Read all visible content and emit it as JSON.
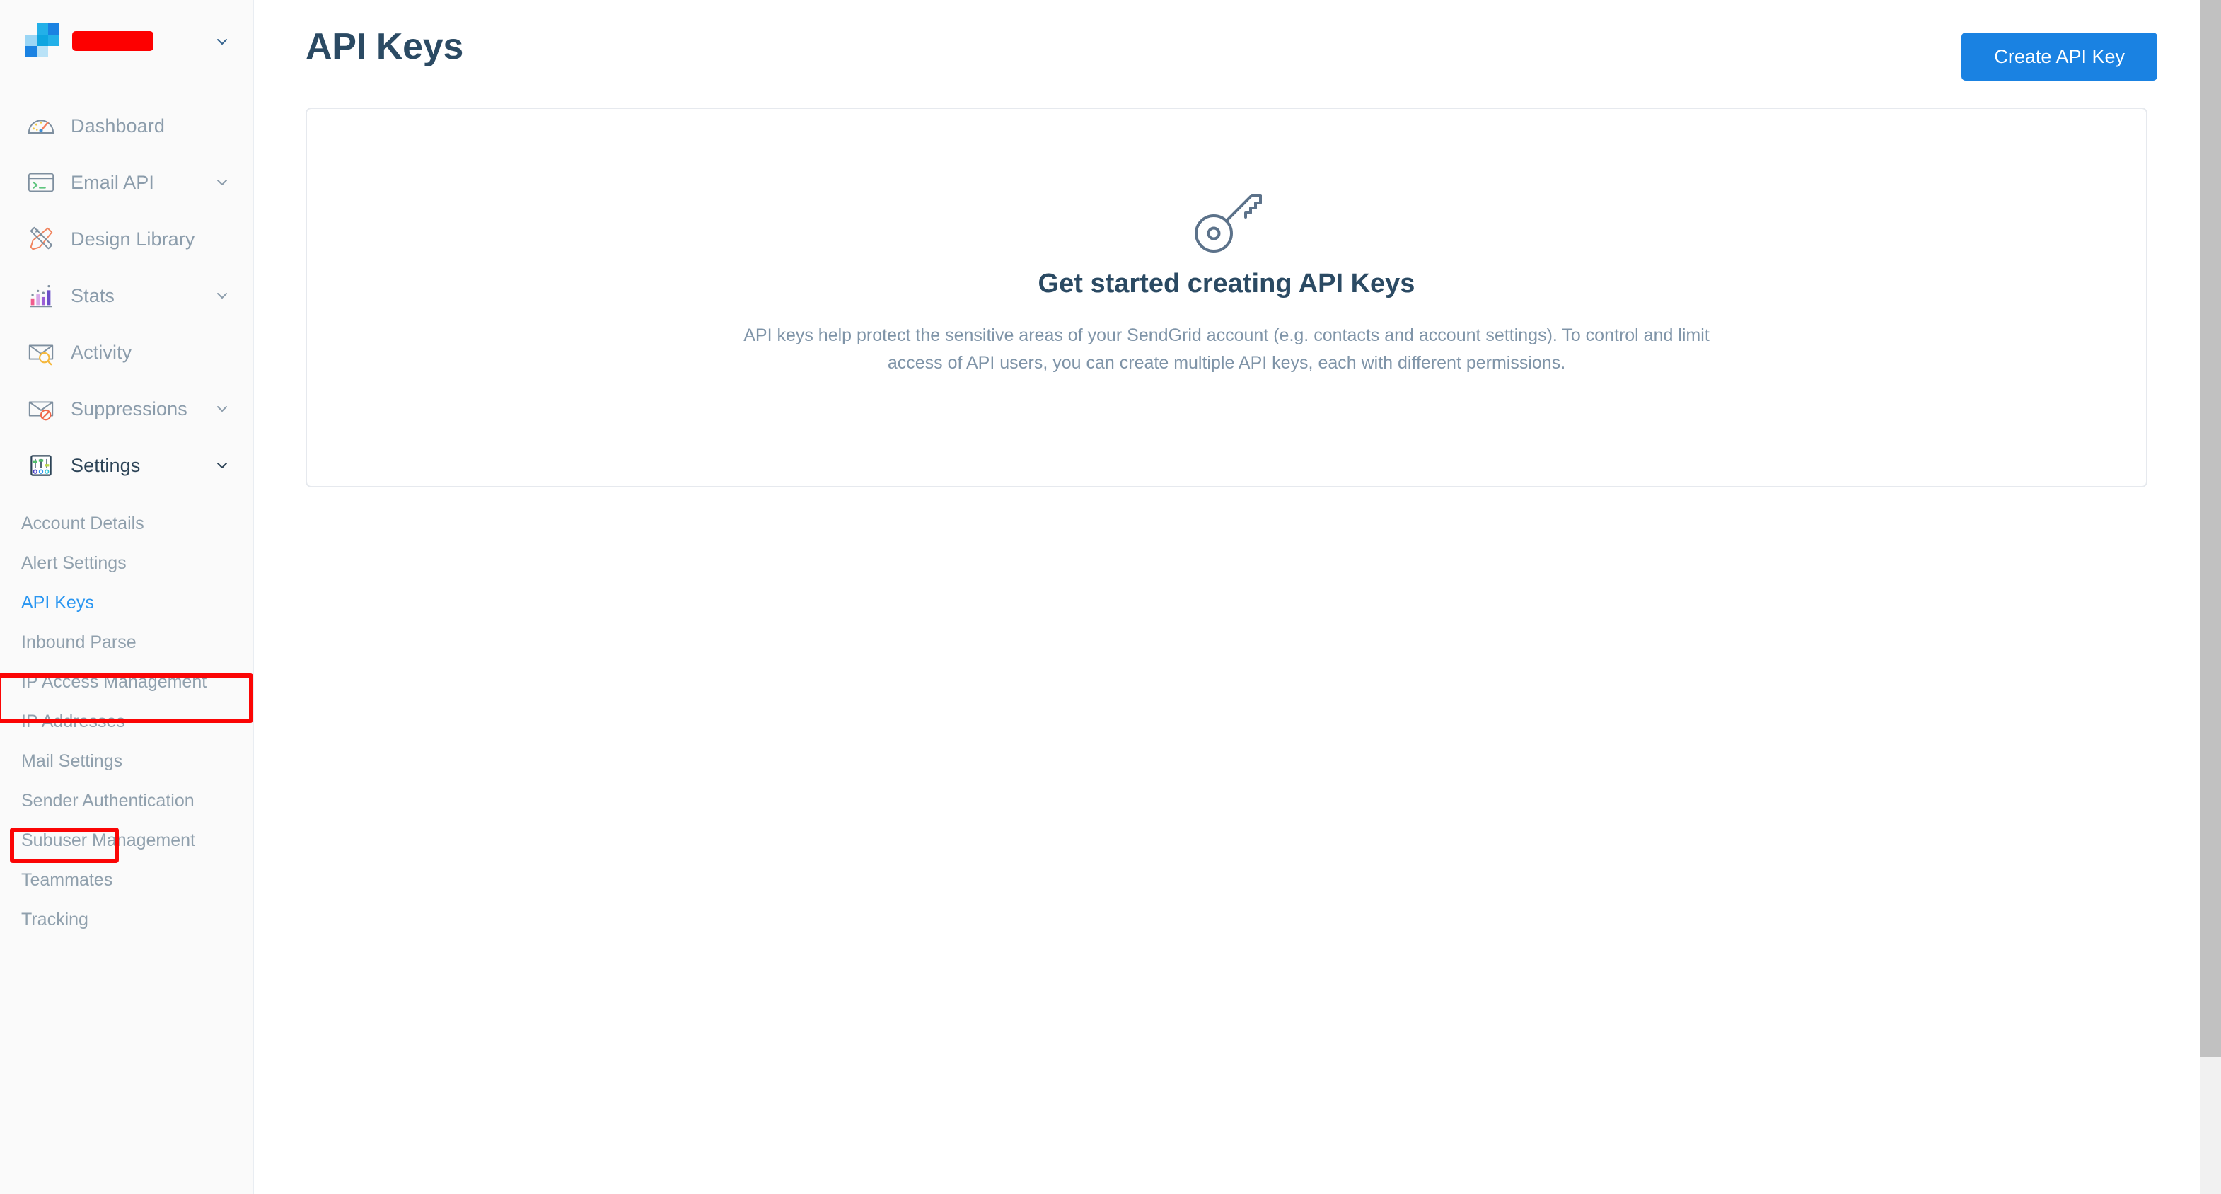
{
  "brand": {
    "logo_name": "sendgrid-logo",
    "account_name_redacted": "████████",
    "caret_icon": "chevron-down-icon",
    "logo_colors": [
      "#9bd6f5",
      "#23b0e8",
      "#1a82e2",
      "#0ea5e0",
      "#b9e2f7"
    ]
  },
  "sidebar": {
    "items": [
      {
        "label": "Dashboard",
        "icon": "speedometer-icon",
        "has_caret": false,
        "active": false
      },
      {
        "label": "Email API",
        "icon": "terminal-window-icon",
        "has_caret": true,
        "active": false
      },
      {
        "label": "Design Library",
        "icon": "ruler-pencil-icon",
        "has_caret": false,
        "active": false
      },
      {
        "label": "Stats",
        "icon": "bar-chart-icon",
        "has_caret": true,
        "active": false
      },
      {
        "label": "Activity",
        "icon": "envelope-search-icon",
        "has_caret": false,
        "active": false
      },
      {
        "label": "Suppressions",
        "icon": "envelope-blocked-icon",
        "has_caret": true,
        "active": false
      },
      {
        "label": "Settings",
        "icon": "sliders-icon",
        "has_caret": true,
        "active": true
      }
    ],
    "settings_submenu": [
      {
        "label": "Account Details",
        "active": false
      },
      {
        "label": "Alert Settings",
        "active": false
      },
      {
        "label": "API Keys",
        "active": true
      },
      {
        "label": "Inbound Parse",
        "active": false
      },
      {
        "label": "IP Access Management",
        "active": false
      },
      {
        "label": "IP Addresses",
        "active": false
      },
      {
        "label": "Mail Settings",
        "active": false
      },
      {
        "label": "Sender Authentication",
        "active": false
      },
      {
        "label": "Subuser Management",
        "active": false
      },
      {
        "label": "Teammates",
        "active": false
      },
      {
        "label": "Tracking",
        "active": false
      }
    ]
  },
  "header": {
    "title": "API Keys",
    "create_button_label": "Create API Key"
  },
  "empty_state": {
    "icon": "key-icon",
    "title": "Get started creating API Keys",
    "body": "API keys help protect the sensitive areas of your SendGrid account (e.g. contacts and account settings). To control and limit access of API users, you can create multiple API keys, each with different permissions."
  },
  "annotations": [
    {
      "name": "settings-highlight",
      "color": "#fb0505"
    },
    {
      "name": "api-keys-highlight",
      "color": "#fb0505"
    }
  ],
  "colors": {
    "accent_blue": "#1a82e2",
    "link_blue": "#2a96f1",
    "title_navy": "#2b4a63",
    "muted_text": "#8b9cab",
    "sidebar_bg": "#fafafa",
    "annotation_red": "#fb0505",
    "scrollbar_thumb": "#c1c1c1"
  }
}
